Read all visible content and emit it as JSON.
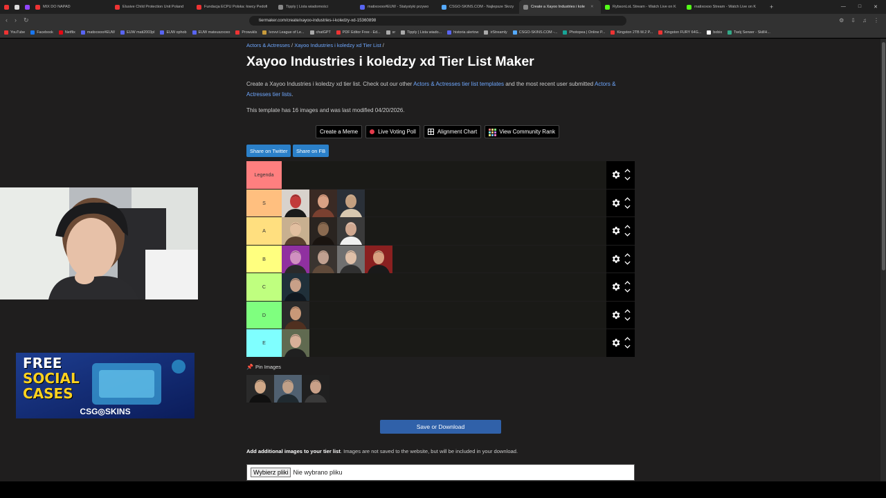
{
  "browser": {
    "tabs": [
      {
        "label": "",
        "color": "#e33",
        "active": false
      },
      {
        "label": "",
        "color": "#ddd",
        "active": false
      },
      {
        "label": "",
        "color": "#9146ff",
        "active": false
      },
      {
        "label": "MIX DO NAPAD",
        "color": "#e33",
        "active": false
      },
      {
        "label": "Elusive Child Protection Unit Poland",
        "color": "#e33",
        "active": false
      },
      {
        "label": "Fundacja ECPU Polska: łowcy Pedofi",
        "color": "#e33",
        "active": false
      },
      {
        "label": "Tipply | Lista wiadomości",
        "color": "#888",
        "active": false
      },
      {
        "label": "matixoxoo#EUW - Statystyki przywo",
        "color": "#5865f2",
        "active": false
      },
      {
        "label": "CSGO-SKINS.COM - Najlepsze Skrzy",
        "color": "#5af",
        "active": false
      },
      {
        "label": "Create a Xayoo Industries i kole",
        "color": "#888",
        "active": true
      },
      {
        "label": "RybsonLoL Stream - Watch Live on K",
        "color": "#53fc18",
        "active": false
      },
      {
        "label": "matixoxoo Stream - Watch Live on K",
        "color": "#53fc18",
        "active": false
      }
    ],
    "url": "tiermaker.com/create/xayoo-industries-i-koledzy-xd-15360898",
    "bookmarks": [
      {
        "label": "YouTube",
        "color": "#e33"
      },
      {
        "label": "Facebook",
        "color": "#1877f2"
      },
      {
        "label": "Netflix",
        "color": "#e50914"
      },
      {
        "label": "matixoxoo#EUW",
        "color": "#5865f2"
      },
      {
        "label": "EUW mati2003pl",
        "color": "#5865f2"
      },
      {
        "label": "EUW ophob",
        "color": "#5865f2"
      },
      {
        "label": "EUW mateuszxoxo",
        "color": "#5865f2"
      },
      {
        "label": "Prowukls",
        "color": "#e33"
      },
      {
        "label": "Ivovvi League of Le...",
        "color": "#c89b3c"
      },
      {
        "label": "chatGPT",
        "color": "#aaa"
      },
      {
        "label": "PDF Editor Free - Ed...",
        "color": "#e33"
      },
      {
        "label": "sr",
        "color": "#aaa"
      },
      {
        "label": "Tipply | Lista wiado...",
        "color": "#aaa"
      },
      {
        "label": "historia alertow",
        "color": "#5865f2"
      },
      {
        "label": "irStreamly",
        "color": "#aaa"
      },
      {
        "label": "CSGO-SKINS.COM -...",
        "color": "#5af"
      },
      {
        "label": "Photopea | Online P...",
        "color": "#18a497"
      },
      {
        "label": "Kingston 2TB M.2 P...",
        "color": "#e33"
      },
      {
        "label": "Kingston FURY 64G...",
        "color": "#e33"
      },
      {
        "label": "bobix",
        "color": "#fff"
      },
      {
        "label": "Twój Serwer - SkillH...",
        "color": "#3a8"
      }
    ]
  },
  "page": {
    "breadcrumb": {
      "category": "Actors & Actresses",
      "sep1": " / ",
      "current": "Xayoo Industries i koledzy xd Tier List",
      "sep2": " /"
    },
    "title": "Xayoo Industries i koledzy xd Tier List Maker",
    "desc_part1": "Create a Xayoo Industries i koledzy xd tier list. Check out our other ",
    "desc_link1": "Actors & Actresses tier list templates",
    "desc_part2": " and the most recent user submitted ",
    "desc_link2": "Actors & Actresses tier lists",
    "desc_part3": ".",
    "meta": "This template has 16 images and was last modified 04/20/2026.",
    "buttons": {
      "meme": "Create a Meme",
      "poll": "Live Voting Poll",
      "alignment": "Alignment Chart",
      "community": "View Community Rank"
    },
    "share_twitter": "Share on Twitter",
    "share_fb": "Share on FB",
    "tiers": [
      {
        "label": "Legenda",
        "color": "#ff7f7f",
        "images": 0
      },
      {
        "label": "S",
        "color": "#ffbf7f",
        "images": 3
      },
      {
        "label": "A",
        "color": "#ffdf7f",
        "images": 3
      },
      {
        "label": "B",
        "color": "#ffff7f",
        "images": 4
      },
      {
        "label": "C",
        "color": "#bfff7f",
        "images": 1
      },
      {
        "label": "D",
        "color": "#7fff7f",
        "images": 1
      },
      {
        "label": "E",
        "color": "#7fffff",
        "images": 1
      }
    ],
    "pin_label": "Pin Images",
    "pinned_images": 3,
    "save_label": "Save or Download",
    "add_bold": "Add additional images to your tier list",
    "add_rest": ". Images are not saved to the website, but will be included in your download.",
    "file_button": "Wybierz pliki",
    "file_status": "Nie wybrano pliku"
  },
  "overlay": {
    "ad_line1": "FREE",
    "ad_line2": "SOCIAL",
    "ad_line3": "CASES",
    "ad_brand": "CSG◎SKINS"
  }
}
